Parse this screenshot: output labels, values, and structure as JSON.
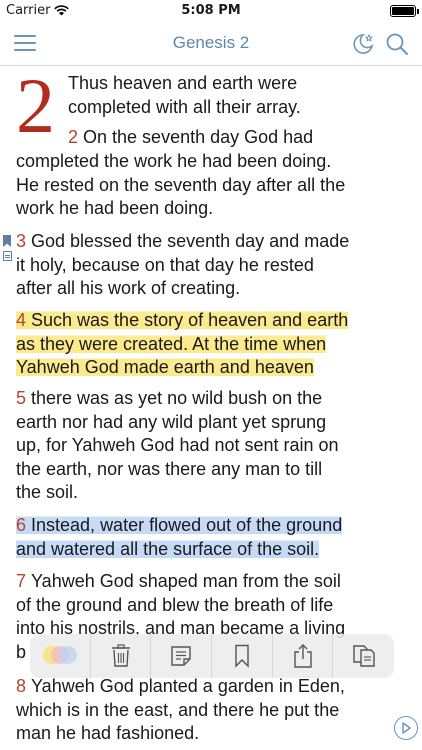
{
  "status_bar": {
    "carrier": "Carrier",
    "time": "5:08 PM"
  },
  "nav": {
    "title": "Genesis 2",
    "icons": [
      "menu-icon",
      "night-mode-icon",
      "search-icon"
    ]
  },
  "chapter": {
    "number": "2",
    "intro_line1": "Thus heaven and earth were",
    "intro_line2": "completed with all their array.",
    "verses": [
      {
        "num": "2",
        "lines": [
          "On the seventh day God had",
          "completed the work he had been doing.",
          "He rested on the seventh day after all the",
          "work he had been doing."
        ]
      },
      {
        "num": "3",
        "lines": [
          "God blessed the seventh day and made",
          "it holy, because on that day he rested",
          "after all his work of creating."
        ],
        "markers": [
          "bookmark-icon",
          "note-icon"
        ]
      },
      {
        "num": "4",
        "lines": [
          "Such was the story of heaven and earth",
          "as they were created. At the time when",
          "Yahweh God made earth and heaven"
        ],
        "highlight": "#fbe98b"
      },
      {
        "num": "5",
        "lines": [
          "there was as yet no wild bush on the",
          "earth nor had any wild plant yet sprung",
          "up, for Yahweh God had not sent rain on",
          "the earth, nor was there any man to till",
          "the soil."
        ]
      },
      {
        "num": "6",
        "lines": [
          "Instead, water flowed out of the ground",
          "and watered all the surface of the soil."
        ],
        "highlight": "#c3d9f6"
      },
      {
        "num": "7",
        "lines": [
          "Yahweh God shaped man from the soil",
          "of the ground and blew the breath of life",
          "into his nostrils, and man became a living",
          "b"
        ]
      },
      {
        "num": "8",
        "lines": [
          "Yahweh God planted a garden in Eden,",
          "which is in the east, and there he put the",
          "man he had fashioned."
        ]
      }
    ]
  },
  "toolbar": {
    "tools": [
      "highlight-colors-icon",
      "trash-icon",
      "note-icon",
      "bookmark-icon",
      "share-icon",
      "copy-icon"
    ],
    "highlight_colors": [
      "#f6e27a",
      "#f4b6c8",
      "#b8d4f1"
    ]
  },
  "play_icon": "play-icon",
  "colors": {
    "accent": "#5d88aa",
    "verse_number": "#b5462a",
    "dropcap": "#b22c1e"
  }
}
